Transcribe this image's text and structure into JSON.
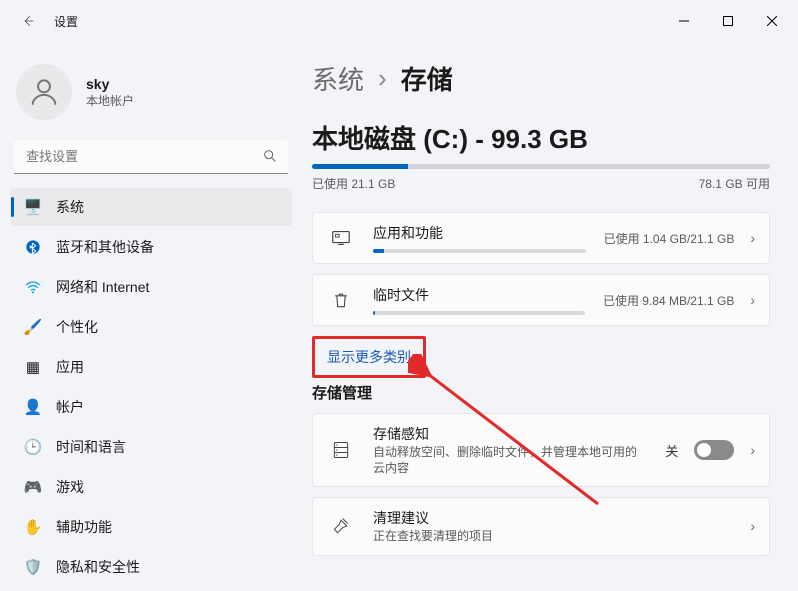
{
  "titlebar": {
    "title": "设置"
  },
  "profile": {
    "username": "sky",
    "account_type": "本地帐户"
  },
  "search": {
    "placeholder": "查找设置"
  },
  "nav": [
    {
      "icon": "🖥️",
      "label": "系统",
      "active": true,
      "name": "sidebar-item-system"
    },
    {
      "icon": "B",
      "label": "蓝牙和其他设备",
      "active": false,
      "name": "sidebar-item-bluetooth",
      "isBt": true
    },
    {
      "icon": "🌐",
      "label": "网络和 Internet",
      "active": false,
      "name": "sidebar-item-network",
      "isWifi": true
    },
    {
      "icon": "🖌️",
      "label": "个性化",
      "active": false,
      "name": "sidebar-item-personalization"
    },
    {
      "icon": "▦",
      "label": "应用",
      "active": false,
      "name": "sidebar-item-apps"
    },
    {
      "icon": "👤",
      "label": "帐户",
      "active": false,
      "name": "sidebar-item-accounts"
    },
    {
      "icon": "🕒",
      "label": "时间和语言",
      "active": false,
      "name": "sidebar-item-time-language"
    },
    {
      "icon": "🎮",
      "label": "游戏",
      "active": false,
      "name": "sidebar-item-gaming"
    },
    {
      "icon": "✋",
      "label": "辅助功能",
      "active": false,
      "name": "sidebar-item-accessibility"
    },
    {
      "icon": "🛡️",
      "label": "隐私和安全性",
      "active": false,
      "name": "sidebar-item-privacy"
    }
  ],
  "breadcrumb": {
    "root": "系统",
    "current": "存储",
    "separator": "›"
  },
  "disk": {
    "title": "本地磁盘 (C:) - 99.3 GB",
    "used_label": "已使用 21.1 GB",
    "free_label": "78.1 GB 可用",
    "used_pct": 21
  },
  "cards": {
    "apps": {
      "title": "应用和功能",
      "right": "已使用 1.04 GB/21.1 GB",
      "fill_pct": 5
    },
    "temp": {
      "title": "临时文件",
      "right": "已使用 9.84 MB/21.1 GB",
      "fill_pct": 1
    }
  },
  "more_link": "显示更多类别",
  "storage_mgmt": {
    "heading": "存储管理",
    "sense": {
      "title": "存储感知",
      "sub": "自动释放空间、删除临时文件，并管理本地可用的云内容",
      "toggle_label": "关"
    },
    "cleanup": {
      "title": "清理建议",
      "sub": "正在查找要清理的项目"
    }
  }
}
